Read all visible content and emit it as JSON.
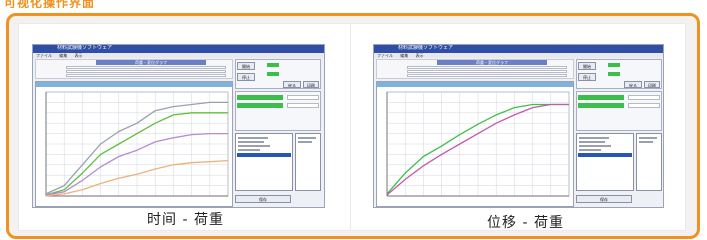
{
  "page": {
    "top_title": "可视化操作界面",
    "accent_color": "#f0921f"
  },
  "window": {
    "title": "材料試験機ソフトウェア",
    "menu_items": [
      "ファイル",
      "編集",
      "表示"
    ],
    "form_banner": "荷重・変位グラフ",
    "buttons": {
      "start": "開始",
      "stop": "停止",
      "return": "戻る",
      "print": "印刷",
      "save": "保存"
    },
    "status": {
      "load_label": "荷重",
      "disp_label": "変位"
    }
  },
  "cards": [
    {
      "caption": "时间 - 荷重",
      "chart_data": {
        "type": "line",
        "x_label": "时间",
        "y_label": "荷重",
        "xlim": [
          0,
          10
        ],
        "ylim": [
          0,
          10
        ],
        "grid": true,
        "series": [
          {
            "color": "#9aa0b3",
            "values": [
              [
                0,
                0.2
              ],
              [
                1,
                1.0
              ],
              [
                2,
                3.0
              ],
              [
                3,
                5.0
              ],
              [
                4,
                6.2
              ],
              [
                5,
                7.0
              ],
              [
                6,
                8.2
              ],
              [
                7,
                8.6
              ],
              [
                8,
                8.8
              ],
              [
                9,
                9.0
              ],
              [
                10,
                9.0
              ]
            ]
          },
          {
            "color": "#5fbf3a",
            "values": [
              [
                0,
                0.1
              ],
              [
                1,
                0.6
              ],
              [
                2,
                2.2
              ],
              [
                3,
                4.0
              ],
              [
                4,
                5.0
              ],
              [
                5,
                6.0
              ],
              [
                6,
                7.0
              ],
              [
                7,
                7.8
              ],
              [
                8,
                8.0
              ],
              [
                9,
                8.0
              ],
              [
                10,
                8.0
              ]
            ]
          },
          {
            "color": "#b58ad6",
            "values": [
              [
                0,
                0.1
              ],
              [
                1,
                0.4
              ],
              [
                2,
                1.5
              ],
              [
                3,
                2.8
              ],
              [
                4,
                3.8
              ],
              [
                5,
                4.4
              ],
              [
                6,
                5.2
              ],
              [
                7,
                5.6
              ],
              [
                8,
                5.9
              ],
              [
                9,
                6.0
              ],
              [
                10,
                6.0
              ]
            ]
          },
          {
            "color": "#f0b07a",
            "values": [
              [
                0,
                0.0
              ],
              [
                1,
                0.2
              ],
              [
                2,
                0.6
              ],
              [
                3,
                1.2
              ],
              [
                4,
                1.7
              ],
              [
                5,
                2.1
              ],
              [
                6,
                2.6
              ],
              [
                7,
                3.0
              ],
              [
                8,
                3.2
              ],
              [
                9,
                3.3
              ],
              [
                10,
                3.4
              ]
            ]
          }
        ]
      }
    },
    {
      "caption": "位移 - 荷重",
      "chart_data": {
        "type": "line",
        "x_label": "位移",
        "y_label": "荷重",
        "xlim": [
          0,
          10
        ],
        "ylim": [
          0,
          10
        ],
        "grid": true,
        "series": [
          {
            "color": "#3fbf4a",
            "values": [
              [
                0,
                0.2
              ],
              [
                1,
                2.2
              ],
              [
                2,
                3.8
              ],
              [
                3,
                4.8
              ],
              [
                4,
                5.9
              ],
              [
                5,
                6.9
              ],
              [
                6,
                7.8
              ],
              [
                7,
                8.5
              ],
              [
                8,
                8.8
              ],
              [
                9,
                8.8
              ],
              [
                10,
                8.8
              ]
            ]
          },
          {
            "color": "#c25ab0",
            "values": [
              [
                0,
                0.1
              ],
              [
                1,
                1.6
              ],
              [
                2,
                2.9
              ],
              [
                3,
                4.0
              ],
              [
                4,
                5.0
              ],
              [
                5,
                6.0
              ],
              [
                6,
                7.0
              ],
              [
                7,
                7.8
              ],
              [
                8,
                8.5
              ],
              [
                9,
                8.8
              ],
              [
                10,
                8.8
              ]
            ]
          }
        ]
      }
    }
  ]
}
